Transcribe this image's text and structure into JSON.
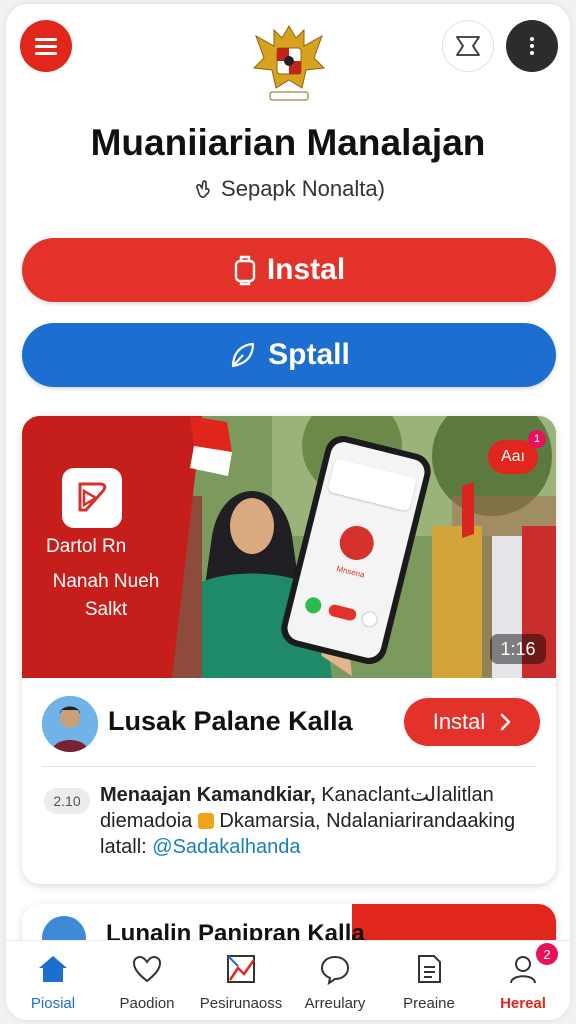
{
  "header": {
    "title": "Muaniiarian Manalajan",
    "subtitle": "Sepapk Nonalta)"
  },
  "actions": {
    "install_label": "Instal",
    "spotall_label": "Sptall"
  },
  "feature_card": {
    "banner_title": "Dartol Rn",
    "banner_subtitle": "Nanah Nueh Salkt",
    "phone_label": "Mnsena",
    "lang_badge": "Aaı",
    "notification_count": "1",
    "duration": "1:16",
    "name": "Lusak Palane Kalla",
    "install_label": "Instal",
    "desc_badge": "2.10",
    "description_bold": "Menaajan Kamandkiar,",
    "description_rest": " Kanaclantالتalitlan diemadoia",
    "description_rest2": "Dkamarsia, Ndalaniarirandaaking latall:",
    "handle": "@Sadakalhanda"
  },
  "second_card": {
    "title": "Lunalin Panipran Kalla"
  },
  "bottom_nav": {
    "items": [
      {
        "label": "Piosial"
      },
      {
        "label": "Paodion"
      },
      {
        "label": "Pesirunaoss"
      },
      {
        "label": "Arreulary"
      },
      {
        "label": "Preaine"
      },
      {
        "label": "Hereal",
        "badge": "2"
      }
    ]
  },
  "colors": {
    "red": "#e1261c",
    "blue": "#1c6fd0",
    "dark": "#2c2c2e"
  }
}
